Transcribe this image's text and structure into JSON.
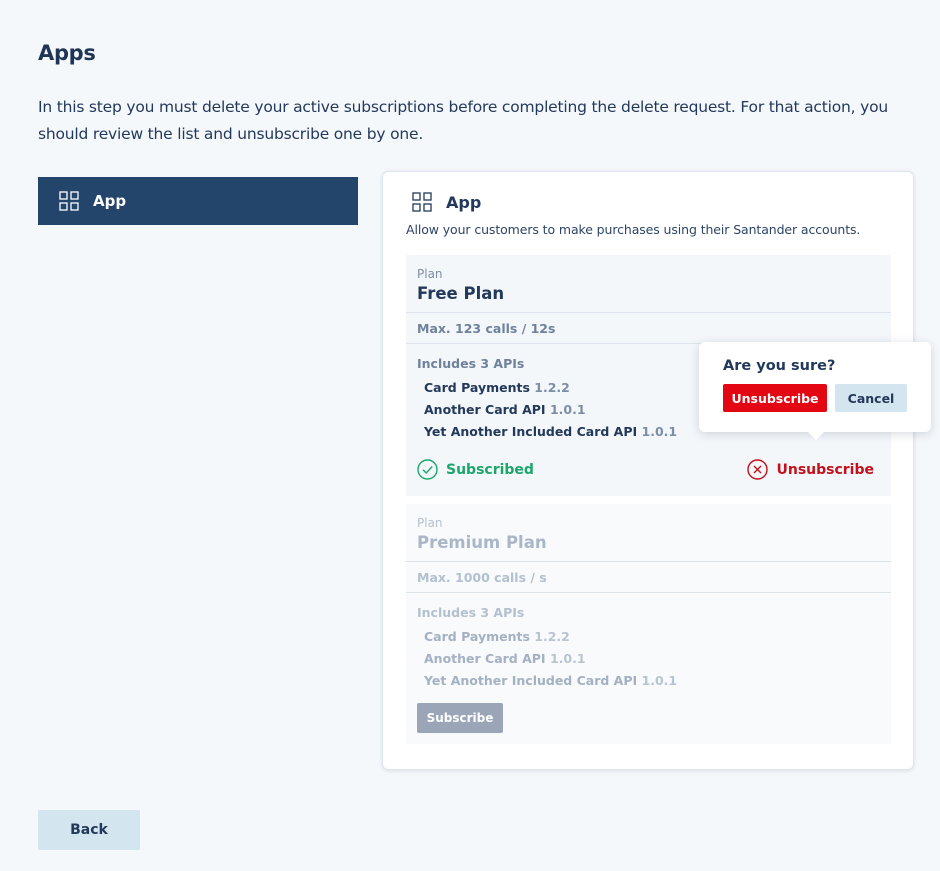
{
  "page": {
    "title": "Apps",
    "intro": "In this step you must delete your active subscriptions before completing the delete request. For that action, you should review the list and unsubscribe one by one."
  },
  "sidebar": {
    "items": [
      {
        "label": "App",
        "icon": "grid-icon",
        "active": true
      }
    ]
  },
  "app_card": {
    "title": "App",
    "icon": "grid-icon",
    "description": "Allow your customers to make purchases using their Santander accounts.",
    "plans": [
      {
        "label": "Plan",
        "name": "Free Plan",
        "limit": "Max. 123 calls / 12s",
        "includes": "Includes 3 APIs",
        "apis": [
          {
            "name": "Card Payments",
            "version": "1.2.2"
          },
          {
            "name": "Another Card API",
            "version": "1.0.1"
          },
          {
            "name": "Yet Another Included Card API",
            "version": "1.0.1"
          }
        ],
        "status": "Subscribed",
        "action": "Unsubscribe"
      },
      {
        "label": "Plan",
        "name": "Premium Plan",
        "limit": "Max. 1000 calls / s",
        "includes": "Includes 3 APIs",
        "apis": [
          {
            "name": "Card Payments",
            "version": "1.2.2"
          },
          {
            "name": "Another Card API",
            "version": "1.0.1"
          },
          {
            "name": "Yet Another Included Card API",
            "version": "1.0.1"
          }
        ],
        "action": "Subscribe"
      }
    ]
  },
  "confirm_popover": {
    "question": "Are you sure?",
    "confirm_label": "Unsubscribe",
    "cancel_label": "Cancel"
  },
  "footer": {
    "back_label": "Back"
  },
  "colors": {
    "primary_navy": "#23446b",
    "text": "#23395b",
    "success": "#1ca66a",
    "danger": "#e30613",
    "danger_text": "#c3101a",
    "secondary_button": "#d3e5ef"
  }
}
